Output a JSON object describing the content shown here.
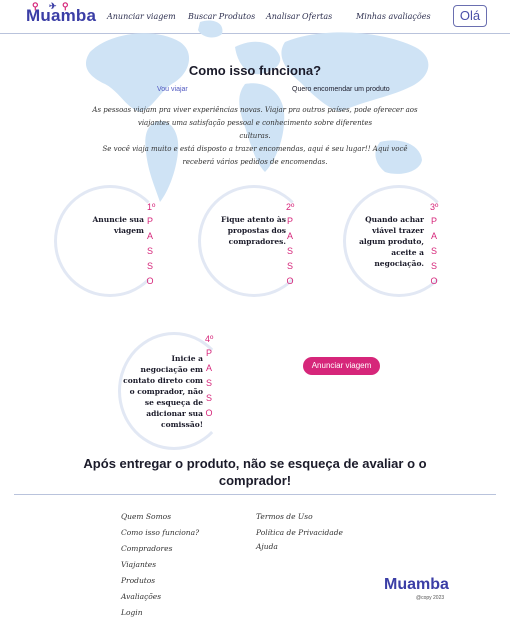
{
  "header": {
    "logo": "Muamba",
    "nav": [
      "Anunciar viagem",
      "Buscar Produtos",
      "Analisar Ofertas",
      "Minhas avaliações"
    ],
    "profile_button": "Olá"
  },
  "hero": {
    "title": "Como isso funciona?",
    "tabs": [
      "Vou viajar",
      "Quero encomendar um produto"
    ],
    "paragraph1_line1": "As pessoas viajam pra viver experiências novas. Viajar pra outros países, pode  oferecer aos",
    "paragraph1_line2": "viajantes uma satisfação pessoal e conhecimento sobre diferentes",
    "paragraph1_line3": "culturas.",
    "paragraph2_line1": "Se você viaja muito e está disposto a trazer encomendas, aqui é seu lugar!!  Aqui você",
    "paragraph2_line2": "receberá vários pedidos de encomendas."
  },
  "steps": [
    {
      "number": "1º",
      "lines": [
        "Anuncie sua",
        "viagem"
      ]
    },
    {
      "number": "2º",
      "lines": [
        "Fique atento às",
        "propostas dos",
        "compradores."
      ]
    },
    {
      "number": "3º",
      "lines": [
        "Quando achar",
        "viável trazer",
        "algum produto,",
        "aceite a",
        "negociação."
      ]
    },
    {
      "number": "4º",
      "lines": [
        "Inicie a",
        "negociação em",
        "contato direto com",
        "o comprador, não",
        "se esqueça de",
        "adicionar sua",
        "comissão!"
      ]
    }
  ],
  "passo_letters": [
    "P",
    "A",
    "S",
    "S",
    "O"
  ],
  "cta_button": "Anunciar viagem",
  "final_message_line1": "Após entregar o produto, não se esqueça de avaliar o o",
  "final_message_line2": "comprador!",
  "footer": {
    "col1": [
      "Quem Somos",
      "Como isso funciona?",
      "Compradores",
      "Viajantes",
      "Produtos",
      "Avaliações",
      "Login"
    ],
    "col2": [
      "Termos de Uso",
      "Política de Privacidade",
      "Ajuda"
    ],
    "logo": "Muamba",
    "copyright": "@copy 2023"
  },
  "colors": {
    "brand": "#3b3ea6",
    "accent": "#d6267a",
    "map": "#cfe3f5"
  }
}
